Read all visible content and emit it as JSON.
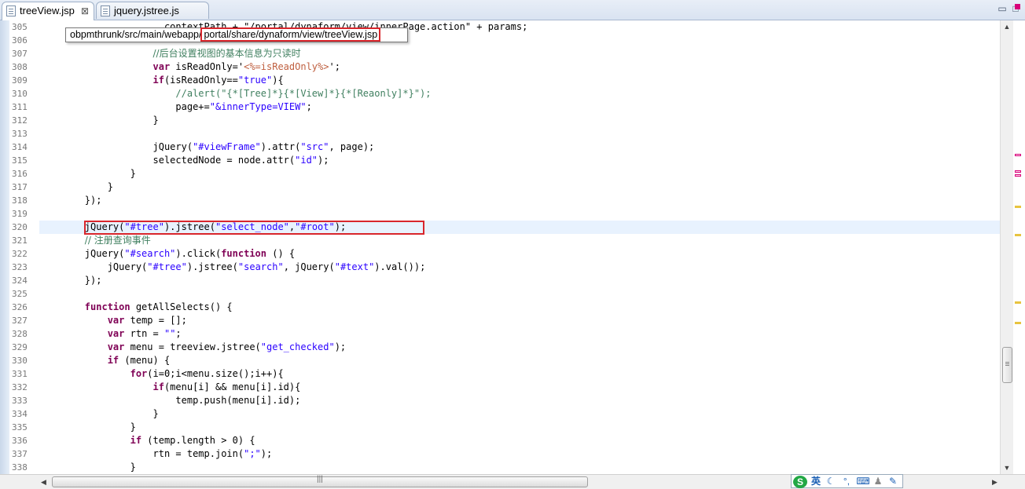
{
  "tabs": [
    {
      "label": "treeView.jsp",
      "close_glyph": "⊠",
      "active": true
    },
    {
      "label": "jquery.jstree.js",
      "active": false
    }
  ],
  "window_controls": {
    "minimize_glyph": "▭",
    "maximize_glyph": "□"
  },
  "tooltip": {
    "prefix": "obpmthrunk/src/main/webapp/",
    "highlight": "portal/share/dynaform/view/treeView.jsp"
  },
  "gutter": {
    "line_numbers": [
      "305",
      "306",
      "307",
      "308",
      "309",
      "310",
      "311",
      "312",
      "313",
      "314",
      "315",
      "316",
      "317",
      "318",
      "319",
      "320",
      "321",
      "322",
      "323",
      "324",
      "325",
      "326",
      "327",
      "328",
      "329",
      "330",
      "331",
      "332",
      "333",
      "334",
      "335",
      "336",
      "337",
      "338"
    ]
  },
  "code": {
    "l305": {
      "text": "                      contextPath + \"/portal/dynaform/view/innerPage.action\" + params;"
    },
    "l307": {
      "comment": "//后台设置视图的基本信息为只读时"
    },
    "l308": {
      "kw": "var",
      "a": " isReadOnly='",
      "jsp": "<%=isReadOnly%>",
      "b": "';"
    },
    "l309": {
      "kw": "if",
      "a": "(isReadOnly==",
      "str": "\"true\"",
      "b": "){"
    },
    "l310": {
      "comment": "//alert(\"{*[Tree]*}{*[View]*}{*[Reaonly]*}\");"
    },
    "l311": {
      "a": "page+=",
      "str": "\"&innerType=VIEW\"",
      "b": ";"
    },
    "l312": {
      "text": "}"
    },
    "l314": {
      "a": "jQuery(",
      "str1": "\"#viewFrame\"",
      "b": ").attr(",
      "str2": "\"src\"",
      "c": ", page);"
    },
    "l315": {
      "a": "selectedNode = node.attr(",
      "str": "\"id\"",
      "b": ");"
    },
    "l316": {
      "text": "}"
    },
    "l317": {
      "text": "}"
    },
    "l318": {
      "text": "});"
    },
    "l320": {
      "a": "jQuery(",
      "str1": "\"#tree\"",
      "b": ").jstree(",
      "str2": "\"select_node\"",
      "c": ",",
      "str3": "\"#root\"",
      "d": ");"
    },
    "l321": {
      "comment": "// 注册查询事件"
    },
    "l322": {
      "a": "jQuery(",
      "str": "\"#search\"",
      "b": ").click(",
      "kw": "function",
      "c": " () {"
    },
    "l323": {
      "a": "jQuery(",
      "str1": "\"#tree\"",
      "b": ").jstree(",
      "str2": "\"search\"",
      "c": ", jQuery(",
      "str3": "\"#text\"",
      "d": ").val());"
    },
    "l324": {
      "text": "});"
    },
    "l326": {
      "kw": "function",
      "a": " getAllSelects() {"
    },
    "l327": {
      "kw": "var",
      "a": " temp = [];"
    },
    "l328": {
      "kw": "var",
      "a": " rtn = ",
      "str": "\"\"",
      "b": ";"
    },
    "l329": {
      "kw": "var",
      "a": " menu = treeview.jstree(",
      "str": "\"get_checked\"",
      "b": ");"
    },
    "l330": {
      "kw": "if",
      "a": " (menu) {"
    },
    "l331": {
      "kw": "for",
      "a": "(i=0;i<menu.size();i++){"
    },
    "l332": {
      "kw": "if",
      "a": "(menu[i] && menu[i].id){"
    },
    "l333": {
      "a": "temp.push(menu[i].id);"
    },
    "l334": {
      "text": "}"
    },
    "l335": {
      "text": "}"
    },
    "l336": {
      "kw": "if",
      "a": " (temp.length > 0) {"
    },
    "l337": {
      "a": "rtn = temp.join(",
      "str": "\";\"",
      "b": ");"
    },
    "l338": {
      "text": "}"
    }
  },
  "ime_bar": {
    "logo": "S",
    "lang": "英",
    "moon": "☾",
    "dot": "°,",
    "kbd": "⌨",
    "user": "♟",
    "tool": "✎"
  },
  "colors": {
    "keyword": "#7f0055",
    "string": "#2a00ff",
    "comment": "#3f7f5f",
    "jsp_tag": "#bf5f3f",
    "current_line": "#e8f2fe",
    "highlight_box": "#d9262c",
    "error_marker": "#d8007a",
    "warning_marker": "#e8c440"
  }
}
